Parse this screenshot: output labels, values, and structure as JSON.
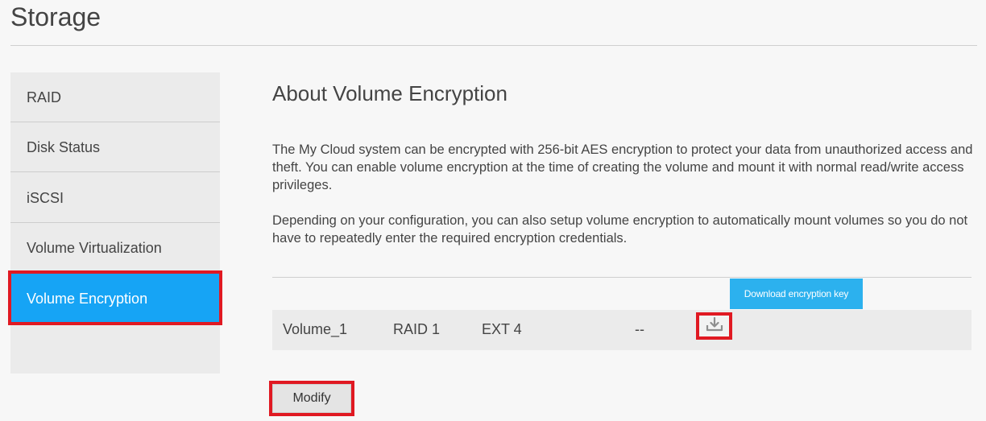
{
  "page": {
    "title": "Storage"
  },
  "sidebar": {
    "items": [
      {
        "label": "RAID",
        "active": false
      },
      {
        "label": "Disk Status",
        "active": false
      },
      {
        "label": "iSCSI",
        "active": false
      },
      {
        "label": "Volume Virtualization",
        "active": false
      },
      {
        "label": "Volume Encryption",
        "active": true
      }
    ]
  },
  "main": {
    "heading": "About Volume Encryption",
    "paragraph1": "The My Cloud system can be encrypted with 256-bit AES encryption to protect your data from unauthorized access and theft. You can enable volume encryption at the time of creating the volume and mount it with normal read/write access privileges.",
    "paragraph2": "Depending on your configuration, you can also setup volume encryption to automatically mount volumes so you do not have to repeatedly enter the required encryption credentials.",
    "tooltip": "Download encryption key",
    "volumes": [
      {
        "name": "Volume_1",
        "raid": "RAID 1",
        "fs": "EXT 4",
        "status": "--"
      }
    ],
    "modify_label": "Modify"
  },
  "colors": {
    "accent": "#16a4f5",
    "tooltip": "#2cb1ee",
    "highlight": "#e01922"
  },
  "icons": {
    "download": "download-icon"
  }
}
